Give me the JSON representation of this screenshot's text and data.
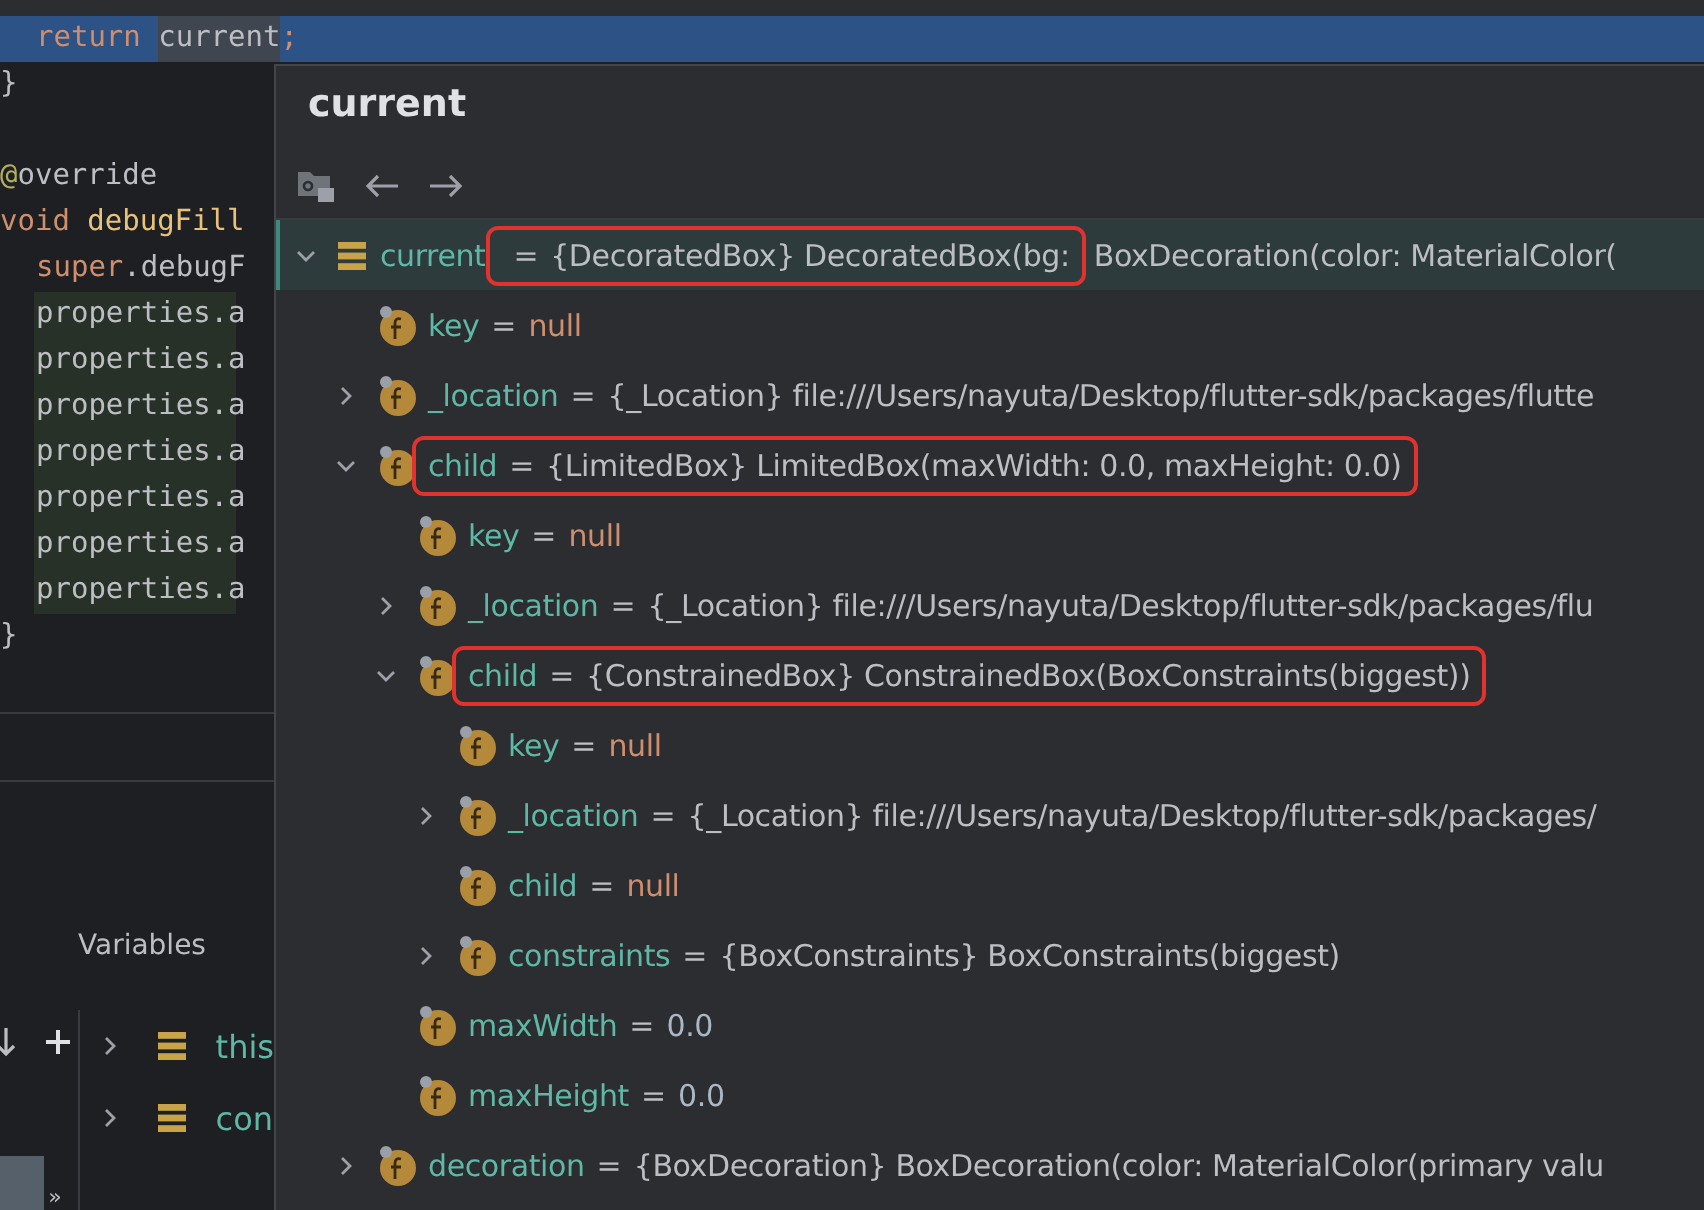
{
  "editor": {
    "lines": [
      {
        "kind": "body",
        "current": true,
        "changed": false,
        "tokens": [
          {
            "text": "return ",
            "kind": "keyword"
          },
          {
            "text": "current",
            "kind": "focus"
          },
          {
            "text": ";",
            "kind": "keyword"
          }
        ]
      },
      {
        "kind": "top",
        "current": false,
        "changed": false,
        "tokens": [
          {
            "text": "}",
            "kind": "plain"
          }
        ]
      },
      {
        "kind": "blank",
        "current": false,
        "changed": false
      },
      {
        "kind": "top",
        "current": false,
        "changed": false,
        "tokens": [
          {
            "text": "@",
            "kind": "annotation"
          },
          {
            "text": "override",
            "kind": "plain"
          }
        ]
      },
      {
        "kind": "top",
        "current": false,
        "changed": false,
        "tokens": [
          {
            "text": "void ",
            "kind": "keyword"
          },
          {
            "text": "debugFill",
            "kind": "method"
          }
        ]
      },
      {
        "kind": "body",
        "current": false,
        "changed": false,
        "tokens": [
          {
            "text": "super",
            "kind": "keyword"
          },
          {
            "text": ".debugF",
            "kind": "plain"
          }
        ]
      },
      {
        "kind": "body",
        "current": false,
        "changed": true,
        "tokens": [
          {
            "text": "properties.a",
            "kind": "plain"
          }
        ]
      },
      {
        "kind": "body",
        "current": false,
        "changed": true,
        "tokens": [
          {
            "text": "properties.a",
            "kind": "plain"
          }
        ]
      },
      {
        "kind": "body",
        "current": false,
        "changed": true,
        "tokens": [
          {
            "text": "properties.a",
            "kind": "plain"
          }
        ]
      },
      {
        "kind": "body",
        "current": false,
        "changed": true,
        "tokens": [
          {
            "text": "properties.a",
            "kind": "plain"
          }
        ]
      },
      {
        "kind": "body",
        "current": false,
        "changed": true,
        "tokens": [
          {
            "text": "properties.a",
            "kind": "plain"
          }
        ]
      },
      {
        "kind": "body",
        "current": false,
        "changed": true,
        "tokens": [
          {
            "text": "properties.a",
            "kind": "plain"
          }
        ]
      },
      {
        "kind": "body",
        "current": false,
        "changed": true,
        "tokens": [
          {
            "text": "properties.a",
            "kind": "plain"
          }
        ]
      },
      {
        "kind": "top",
        "current": false,
        "changed": false,
        "tokens": [
          {
            "text": "}",
            "kind": "plain"
          }
        ]
      }
    ]
  },
  "variables_panel": {
    "title": "Variables",
    "overflow": "»",
    "items": [
      {
        "name": "this",
        "expanded": false
      },
      {
        "name": "con",
        "expanded": false
      }
    ]
  },
  "popup": {
    "title": "current",
    "tree": [
      {
        "kind": "object",
        "name": "current",
        "op": "=",
        "value": {
          "text": "{DecoratedBox} DecoratedBox(bg:",
          "kind": "object"
        },
        "value_tail": "BoxDecoration(color: MaterialColor(",
        "outlined": true,
        "selected": true,
        "expanded": true,
        "children": [
          {
            "kind": "field",
            "name": "key",
            "op": "=",
            "value": {
              "text": "null",
              "kind": "null"
            },
            "outlined": false,
            "selected": false
          },
          {
            "kind": "field",
            "name": "_location",
            "op": "=",
            "value": {
              "text": "{_Location} file:///Users/nayuta/Desktop/flutter-sdk/packages/flutte",
              "kind": "object"
            },
            "outlined": false,
            "selected": false,
            "expanded": false
          },
          {
            "kind": "field",
            "name": "child",
            "op": "=",
            "value": {
              "text": "{LimitedBox} LimitedBox(maxWidth: 0.0, maxHeight: 0.0)",
              "kind": "object"
            },
            "outlined": true,
            "selected": false,
            "expanded": true,
            "children": [
              {
                "kind": "field",
                "name": "key",
                "op": "=",
                "value": {
                  "text": "null",
                  "kind": "null"
                },
                "outlined": false,
                "selected": false
              },
              {
                "kind": "field",
                "name": "_location",
                "op": "=",
                "value": {
                  "text": "{_Location} file:///Users/nayuta/Desktop/flutter-sdk/packages/flu",
                  "kind": "object"
                },
                "outlined": false,
                "selected": false,
                "expanded": false
              },
              {
                "kind": "field",
                "name": "child",
                "op": "=",
                "value": {
                  "text": "{ConstrainedBox} ConstrainedBox(BoxConstraints(biggest))",
                  "kind": "object"
                },
                "outlined": true,
                "selected": false,
                "expanded": true,
                "children": [
                  {
                    "kind": "field",
                    "name": "key",
                    "op": "=",
                    "value": {
                      "text": "null",
                      "kind": "null"
                    },
                    "outlined": false,
                    "selected": false
                  },
                  {
                    "kind": "field",
                    "name": "_location",
                    "op": "=",
                    "value": {
                      "text": "{_Location} file:///Users/nayuta/Desktop/flutter-sdk/packages/",
                      "kind": "object"
                    },
                    "outlined": false,
                    "selected": false,
                    "expanded": false
                  },
                  {
                    "kind": "field",
                    "name": "child",
                    "op": "=",
                    "value": {
                      "text": "null",
                      "kind": "null"
                    },
                    "outlined": false,
                    "selected": false
                  },
                  {
                    "kind": "field",
                    "name": "constraints",
                    "op": "=",
                    "value": {
                      "text": "{BoxConstraints} BoxConstraints(biggest)",
                      "kind": "object"
                    },
                    "outlined": false,
                    "selected": false,
                    "expanded": false
                  }
                ]
              },
              {
                "kind": "field",
                "name": "maxWidth",
                "op": "=",
                "value": {
                  "text": "0.0",
                  "kind": "number"
                },
                "outlined": false,
                "selected": false
              },
              {
                "kind": "field",
                "name": "maxHeight",
                "op": "=",
                "value": {
                  "text": "0.0",
                  "kind": "number"
                },
                "outlined": false,
                "selected": false
              }
            ]
          },
          {
            "kind": "field",
            "name": "decoration",
            "op": "=",
            "value": {
              "text": "{BoxDecoration} BoxDecoration(color: MaterialColor(primary valu",
              "kind": "object"
            },
            "outlined": false,
            "selected": false,
            "expanded": false
          }
        ]
      }
    ]
  }
}
